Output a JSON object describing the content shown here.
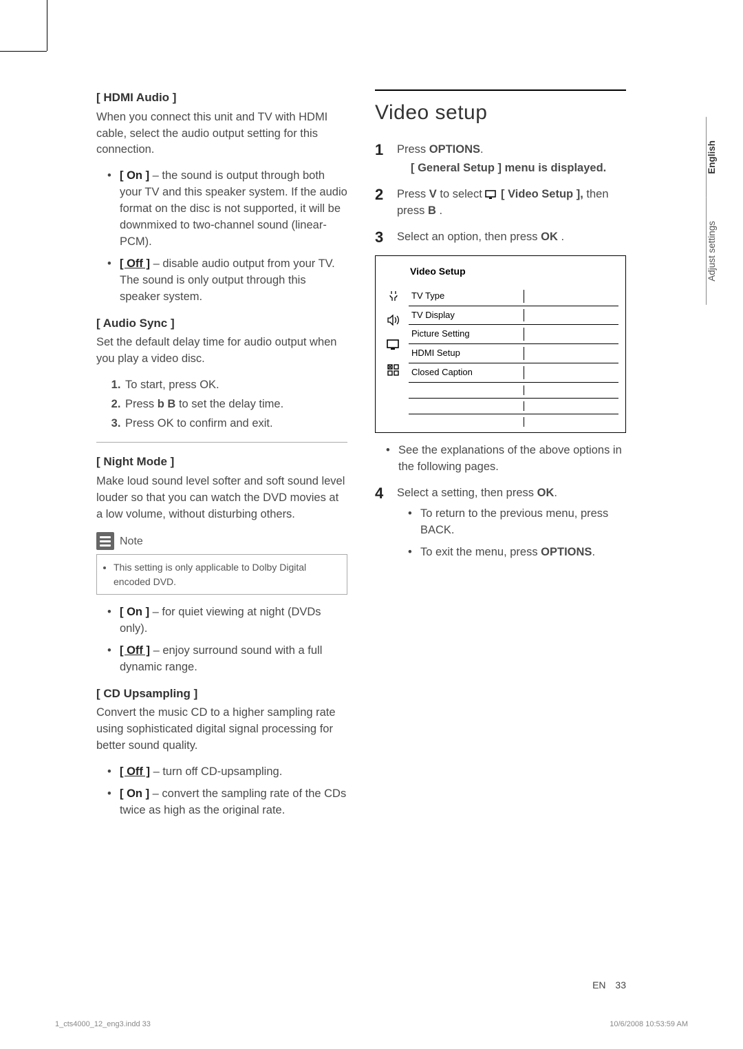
{
  "left": {
    "hdmi": {
      "heading": "[ HDMI Audio ]",
      "desc": "When you connect this unit and TV with HDMI cable, select the audio output setting for this connection.",
      "on_label": "[ On ]",
      "on_text": " – the sound is output through both your TV and this speaker system. If the audio format on the disc is not supported, it will be downmixed to two-channel sound (linear-PCM).",
      "off_label": "[ Off ]",
      "off_text": " – disable audio output from your TV. The sound is only output through this speaker system."
    },
    "audioSync": {
      "heading": "[ Audio Sync ]",
      "desc": "Set the default delay time for audio output when you play a video disc.",
      "s1": "To start, press OK.",
      "s2_a": "Press ",
      "s2_b": "b B",
      "s2_c": "  to set the delay time.",
      "s3": "Press OK to conﬁrm and exit."
    },
    "nightMode": {
      "heading": "[ Night Mode ]",
      "desc": "Make loud sound level softer and soft sound level louder so that you can watch the DVD movies at a low volume, without disturbing others.",
      "noteLabel": "Note",
      "noteText": "This setting is only applicable to Dolby Digital encoded DVD.",
      "on_label": "[ On ]",
      "on_text": " – for quiet viewing at night (DVDs only).",
      "off_label": "[ Off ]",
      "off_text": " – enjoy surround sound with a full dynamic range."
    },
    "cdUp": {
      "heading": "[ CD Upsampling ]",
      "desc": "Convert the music CD to a higher sampling rate using sophisticated digital signal processing for better sound quality.",
      "off_label": "[ Off ]",
      "off_text": " – turn off CD-upsampling.",
      "on_label": "[ On ]",
      "on_text": " – convert the sampling rate of the CDs twice as high as the original rate."
    }
  },
  "right": {
    "title": "Video setup",
    "step1_a": "Press ",
    "step1_b": "OPTIONS",
    "step1_c": ".",
    "step1_result": "[ General Setup ] menu is displayed.",
    "step2_a": "Press ",
    "step2_b": "V",
    "step2_c": " to select ",
    "step2_d": " [ Video Setup ],",
    "step2_e": " then press ",
    "step2_f": "B",
    "step2_g": " .",
    "step3_a": "Select an option, then press ",
    "step3_b": "OK",
    "step3_c": " .",
    "osd": {
      "title": "Video Setup",
      "rows": [
        "TV Type",
        "TV Display",
        "Picture Setting",
        "HDMI Setup",
        "Closed Caption"
      ]
    },
    "above_note": "See the explanations of the above options in the following pages.",
    "step4_a": "Select a setting, then press ",
    "step4_b": "OK",
    "step4_c": ".",
    "step4_r1": "To return to the previous menu, press BACK.",
    "step4_r2_a": "To exit the menu, press ",
    "step4_r2_b": "OPTIONS",
    "step4_r2_c": "."
  },
  "side": {
    "lang": "English",
    "section": "Adjust settings"
  },
  "footer": {
    "lang": "EN",
    "page": "33",
    "print_left": "1_cts4000_12_eng3.indd   33",
    "print_right": "10/6/2008   10:53:59 AM"
  }
}
